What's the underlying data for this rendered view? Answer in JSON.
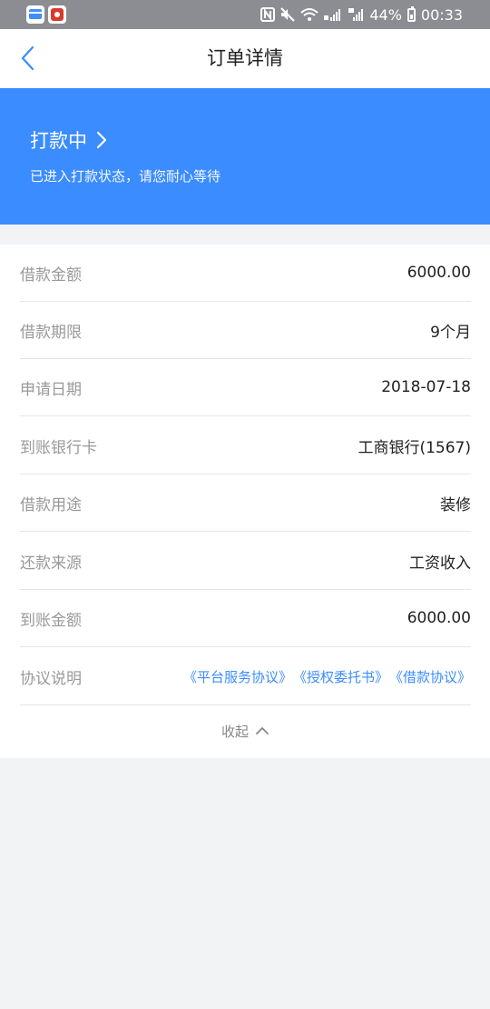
{
  "status_bar": {
    "battery": "44%",
    "time": "00:33"
  },
  "nav": {
    "title": "订单详情"
  },
  "banner": {
    "status": "打款中",
    "description": "已进入打款状态，请您耐心等待"
  },
  "details": {
    "rows": [
      {
        "label": "借款金额",
        "value": "6000.00"
      },
      {
        "label": "借款期限",
        "value": "9个月"
      },
      {
        "label": "申请日期",
        "value": "2018-07-18"
      },
      {
        "label": "到账银行卡",
        "value": "工商银行(1567)"
      },
      {
        "label": "借款用途",
        "value": "装修"
      },
      {
        "label": "还款来源",
        "value": "工资收入"
      },
      {
        "label": "到账金额",
        "value": "6000.00"
      }
    ],
    "agreement_label": "协议说明",
    "agreements": [
      "《平台服务协议》",
      "《授权委托书》",
      "《借款协议》"
    ],
    "collapse_label": "收起"
  },
  "colors": {
    "accent": "#3b8cfe",
    "status_bar": "#8b8d92",
    "background": "#f2f3f5"
  }
}
